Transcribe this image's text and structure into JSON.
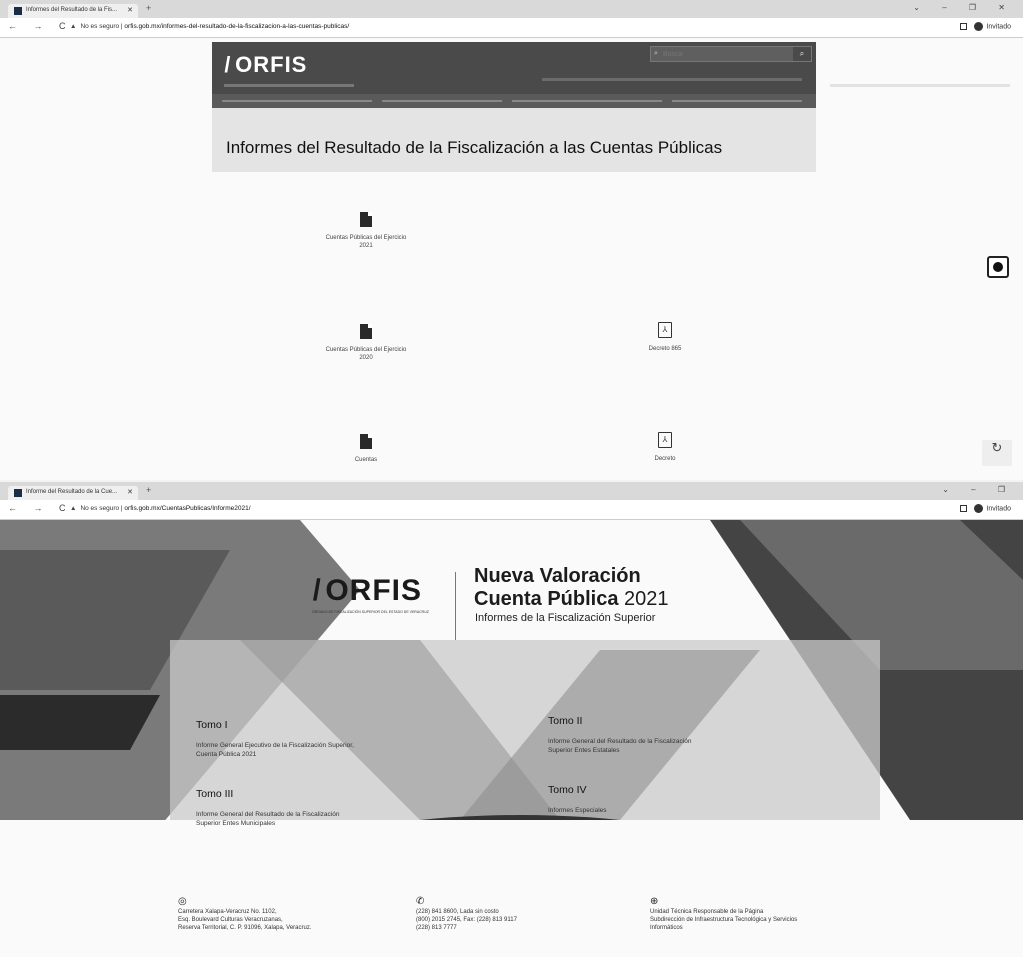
{
  "screen1": {
    "browser": {
      "tab_title": "Informes del Resultado de la Fis...",
      "new_tab": "+",
      "win_controls": "⌄ – ❐ ✕",
      "nav": "← → C",
      "security": "No es seguro",
      "url": "orfis.gob.mx/informes-del-resultado-de-la-fiscalizacion-a-las-cuentas-publicas/",
      "profile": "Invitado"
    },
    "header": {
      "logo": "ORFIS",
      "search_placeholder": "Busca",
      "search_button": "⌕"
    },
    "page_title": "Informes del Resultado de la Fiscalización a las Cuentas Públicas",
    "documents": [
      {
        "label": "Cuentas Públicas del Ejercicio 2021",
        "icon": "file-icon"
      },
      {
        "label": "Cuentas Públicas del Ejercicio 2020",
        "icon": "file-icon"
      },
      {
        "label": "Decreto 865",
        "icon": "pdf-icon"
      },
      {
        "label": "Cuentas",
        "icon": "file-icon"
      },
      {
        "label": "Decreto",
        "icon": "pdf-icon"
      }
    ]
  },
  "screen2": {
    "browser": {
      "tab_title": "Informe del Resultado de la Cue...",
      "new_tab": "+",
      "win_controls": "⌄ – ❐",
      "nav": "← → C",
      "security": "No es seguro",
      "url": "orfis.gob.mx/CuentasPublicas/Informe2021/",
      "profile": "Invitado"
    },
    "brand": {
      "logo": "ORFIS",
      "tagline": "ÓRGANO DE FISCALIZACIÓN SUPERIOR DEL ESTADO DE VERACRUZ",
      "title1": "Nueva Valoración",
      "title2_bold": "Cuenta Pública",
      "title2_year": " 2021",
      "subtitle": "Informes de la Fiscalización Superior"
    },
    "tomos": [
      {
        "title": "Tomo I",
        "desc": "Informe General Ejecutivo de la Fiscalización Superior, Cuenta Pública 2021"
      },
      {
        "title": "Tomo II",
        "desc": "Informe General del Resultado de la Fiscalización Superior Entes Estatales"
      },
      {
        "title": "Tomo III",
        "desc": "Informe General del Resultado de la Fiscalización Superior Entes Municipales"
      },
      {
        "title": "Tomo IV",
        "desc": "Informes Especiales"
      }
    ],
    "footer": {
      "address": [
        "Carretera Xalapa-Veracruz No. 1102,",
        "Esq. Boulevard Culturas Veracruzanas,",
        "Reserva Territorial, C. P. 91096, Xalapa, Veracruz."
      ],
      "phones": [
        "(228) 841 8600, Lada sin costo",
        "(800) 2015 2745, Fax: (228) 813 9117",
        "(228) 813 7777"
      ],
      "unit": [
        "Unidad Técnica Responsable de la Página",
        "Subdirección de Infraestructura Tecnológica y Servicios",
        "Informáticos"
      ]
    }
  }
}
